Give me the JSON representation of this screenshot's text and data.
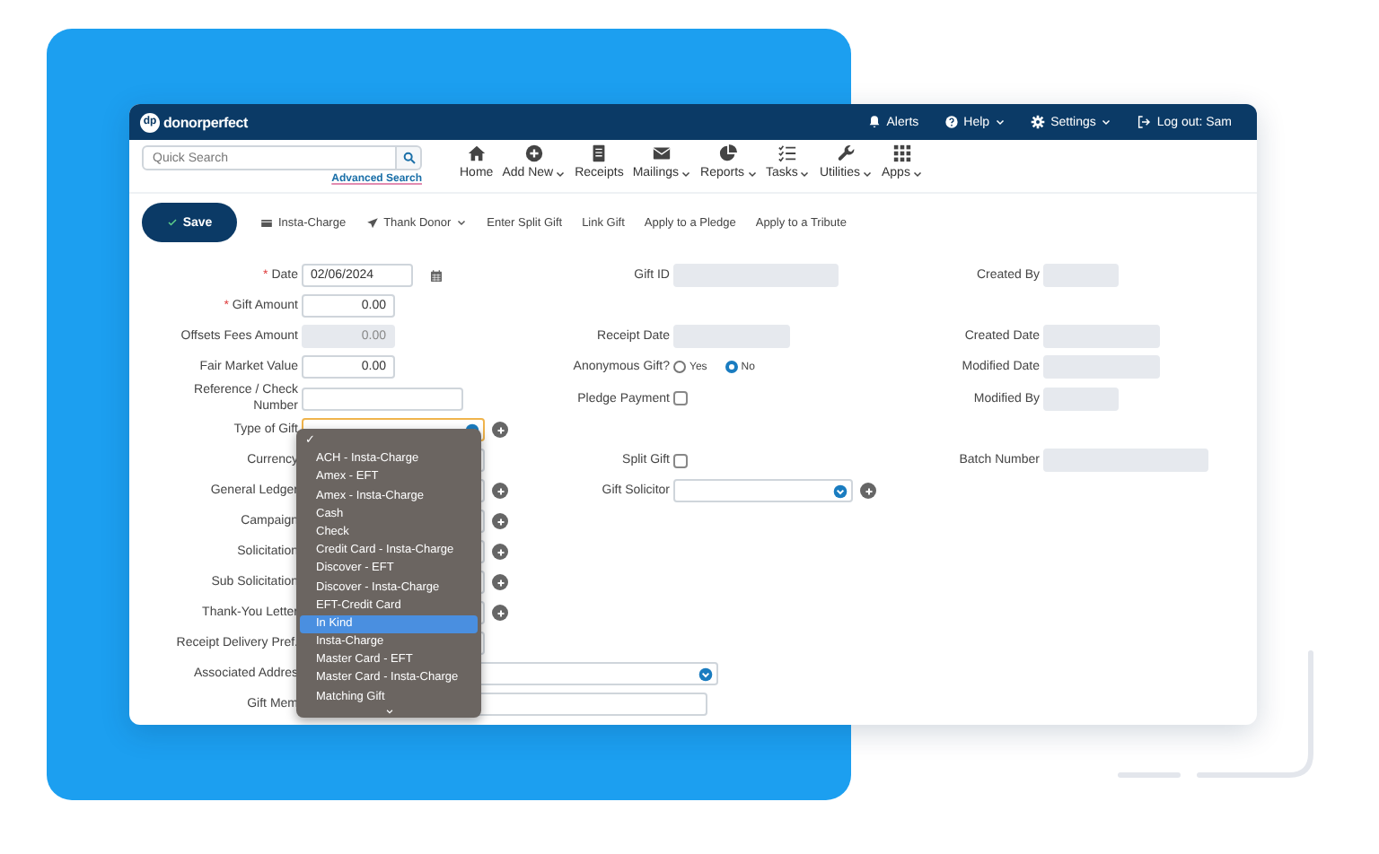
{
  "header": {
    "logo_mark": "dp",
    "brand": "donorperfect",
    "items": [
      {
        "label": "Alerts",
        "has_menu": false
      },
      {
        "label": "Help",
        "has_menu": true
      },
      {
        "label": "Settings",
        "has_menu": true
      },
      {
        "label": "Log out: Sam",
        "has_menu": false
      }
    ]
  },
  "toolbar": {
    "search": {
      "placeholder": "Quick Search"
    },
    "advanced_link": "Advanced Search",
    "nav": [
      {
        "label": "Home",
        "has_menu": false
      },
      {
        "label": "Add New",
        "has_menu": true
      },
      {
        "label": "Receipts",
        "has_menu": false
      },
      {
        "label": "Mailings",
        "has_menu": true
      },
      {
        "label": "Reports",
        "has_menu": true
      },
      {
        "label": "Tasks",
        "has_menu": true
      },
      {
        "label": "Utilities",
        "has_menu": true
      },
      {
        "label": "Apps",
        "has_menu": true
      }
    ]
  },
  "actions": [
    {
      "label": "Save",
      "kind": "primary",
      "has_menu": false
    },
    {
      "label": "Insta-Charge",
      "kind": "link",
      "has_menu": false
    },
    {
      "label": "Thank Donor",
      "kind": "link",
      "has_menu": true
    },
    {
      "label": "Enter Split Gift",
      "kind": "link",
      "has_menu": false
    },
    {
      "label": "Link Gift",
      "kind": "link",
      "has_menu": false
    },
    {
      "label": "Apply to a Pledge",
      "kind": "link",
      "has_menu": false
    },
    {
      "label": "Apply to a Tribute",
      "kind": "link",
      "has_menu": false
    }
  ],
  "form": {
    "rows": [
      {
        "left": {
          "label": "Date",
          "required_mark": "*",
          "kind": "date",
          "value": "02/06/2024"
        },
        "middle": {
          "label": "Gift ID",
          "kind": "readonly"
        },
        "right": {
          "label": "Created By",
          "kind": "readonly"
        }
      },
      {
        "left": {
          "label": "Gift Amount",
          "required_mark": "*",
          "kind": "amount",
          "value": "0.00",
          "disabled": false
        }
      },
      {
        "left": {
          "label": "Offsets Fees Amount",
          "kind": "amount",
          "value": "0.00",
          "disabled": true
        },
        "middle": {
          "label": "Receipt Date",
          "kind": "readonly"
        },
        "right": {
          "label": "Created Date",
          "kind": "readonly"
        }
      },
      {
        "left": {
          "label": "Fair Market Value",
          "kind": "amount",
          "value": "0.00",
          "disabled": false
        },
        "middle": {
          "label": "Anonymous Gift?",
          "kind": "radio",
          "options": [
            {
              "label": "Yes",
              "selected": false
            },
            {
              "label": "No",
              "selected": true
            }
          ]
        },
        "right": {
          "label": "Modified Date",
          "kind": "readonly"
        }
      },
      {
        "left": {
          "label": "Reference / Check Number",
          "kind": "text"
        },
        "middle": {
          "label": "Pledge Payment",
          "kind": "checkbox",
          "checked": false
        },
        "right": {
          "label": "Modified By",
          "kind": "readonly"
        }
      },
      {
        "left": {
          "label": "Type of Gift",
          "kind": "select",
          "focused": true,
          "add_button": true
        }
      },
      {
        "left": {
          "label": "Currency",
          "kind": "select",
          "focused": false,
          "add_button": false
        },
        "middle": {
          "label": "Split Gift",
          "kind": "checkbox",
          "checked": false
        },
        "right": {
          "label": "Batch Number",
          "kind": "readonly"
        }
      },
      {
        "left": {
          "label": "General Ledger",
          "kind": "select",
          "focused": false,
          "add_button": true
        },
        "middle": {
          "label": "Gift Solicitor",
          "kind": "select",
          "focused": false,
          "add_button": true
        }
      },
      {
        "left": {
          "label": "Campaign",
          "kind": "select",
          "focused": false,
          "add_button": true
        }
      },
      {
        "left": {
          "label": "Solicitation",
          "kind": "select",
          "focused": false,
          "add_button": true
        }
      },
      {
        "left": {
          "label": "Sub Solicitation",
          "kind": "select",
          "focused": false,
          "add_button": true
        }
      },
      {
        "left": {
          "label": "Thank-You Letter",
          "kind": "select",
          "focused": false,
          "add_button": true
        }
      },
      {
        "left": {
          "label": "Receipt Delivery Pref.",
          "kind": "select",
          "focused": false,
          "add_button": false
        }
      },
      {
        "left": {
          "label": "Associated Addres",
          "kind": "wide_select"
        }
      },
      {
        "left": {
          "label": "Gift Mem",
          "kind": "wide_text"
        }
      }
    ]
  },
  "dropdown": {
    "check_mark": "✓",
    "options": [
      {
        "label": "ACH - Insta-Charge",
        "highlighted": false
      },
      {
        "label": "Amex - EFT",
        "highlighted": false
      },
      {
        "label": "Amex - Insta-Charge",
        "highlighted": false
      },
      {
        "label": "Cash",
        "highlighted": false
      },
      {
        "label": "Check",
        "highlighted": false
      },
      {
        "label": "Credit Card - Insta-Charge",
        "highlighted": false
      },
      {
        "label": "Discover - EFT",
        "highlighted": false
      },
      {
        "label": "Discover - Insta-Charge",
        "highlighted": false
      },
      {
        "label": "EFT-Credit Card",
        "highlighted": false
      },
      {
        "label": "In Kind",
        "highlighted": true
      },
      {
        "label": "Insta-Charge",
        "highlighted": false
      },
      {
        "label": "Master Card - EFT",
        "highlighted": false
      },
      {
        "label": "Master Card - Insta-Charge",
        "highlighted": false
      },
      {
        "label": "Matching Gift",
        "highlighted": false
      }
    ]
  }
}
